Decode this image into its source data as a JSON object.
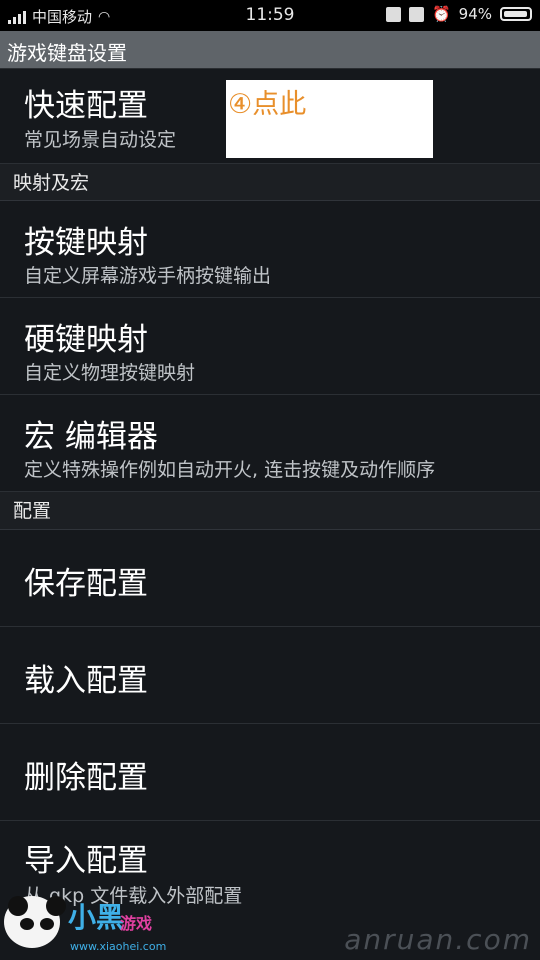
{
  "status_bar": {
    "carrier": "中国移动",
    "time": "11:59",
    "battery": "94%",
    "battery_level": 0.94
  },
  "app_bar": {
    "title": "游戏键盘设置"
  },
  "annotation": {
    "text": "④点此"
  },
  "items": {
    "quick_config": {
      "title": "快速配置",
      "subtitle": "常见场景自动设定"
    },
    "key_mapping": {
      "title": "按键映射",
      "subtitle": "自定义屏幕游戏手柄按键输出"
    },
    "hard_key_mapping": {
      "title": "硬键映射",
      "subtitle": "自定义物理按键映射"
    },
    "macro_editor": {
      "title": "宏 编辑器",
      "subtitle": "定义特殊操作例如自动开火, 连击按键及动作顺序"
    },
    "save_config": {
      "title": "保存配置"
    },
    "load_config": {
      "title": "载入配置"
    },
    "delete_config": {
      "title": "删除配置"
    },
    "import_config": {
      "title": "导入配置",
      "subtitle": "从 gkp 文件载入外部配置"
    }
  },
  "sections": {
    "mapping_macro": "映射及宏",
    "config": "配置"
  },
  "watermarks": {
    "right": "anruan.com",
    "left_brand": "小黑",
    "left_brand2": "游戏",
    "left_url": "www.xiaohei.com"
  }
}
